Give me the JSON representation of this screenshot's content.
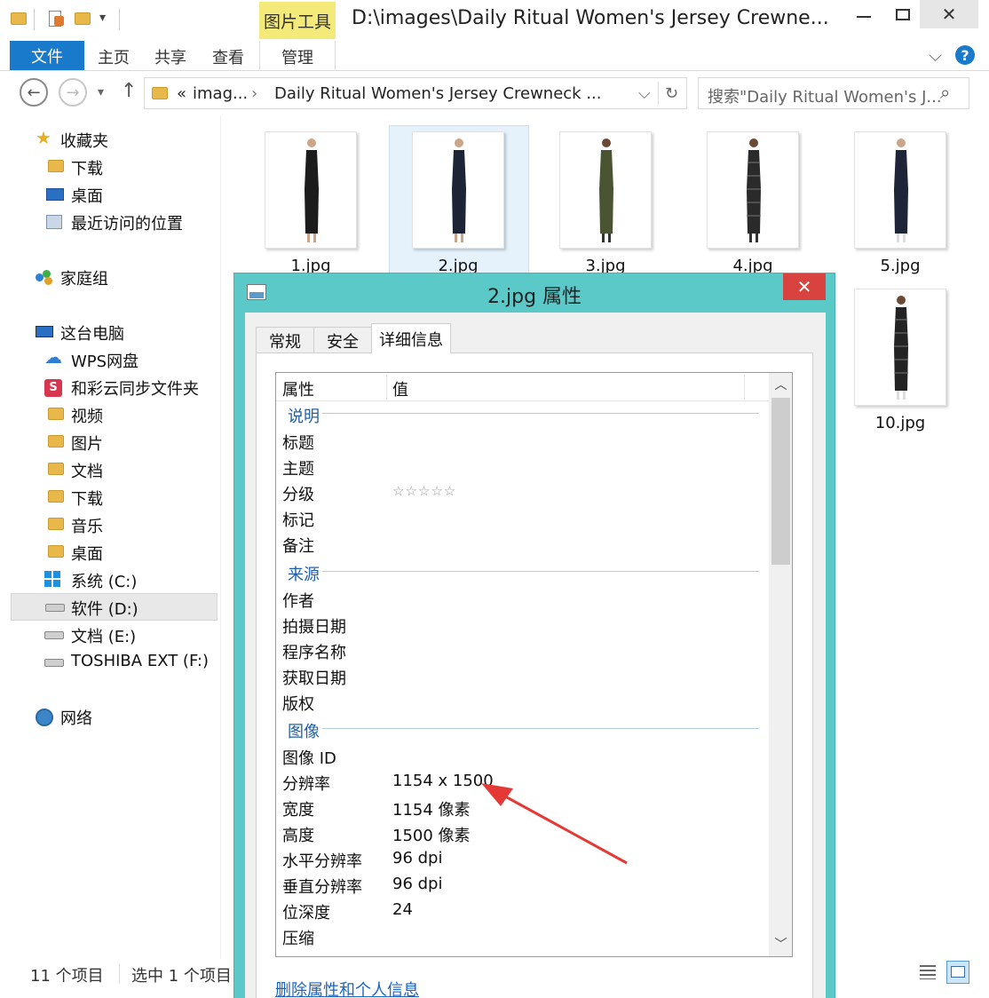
{
  "window": {
    "title": "D:\\images\\Daily Ritual Women's Jersey Crewne...",
    "tool_tab": "图片工具",
    "minimize_icon": "▭",
    "restore_icon": "□",
    "close_icon": "✕"
  },
  "ribbon": {
    "tabs": [
      "文件",
      "主页",
      "共享",
      "查看",
      "管理"
    ],
    "expand_icon": "⌵",
    "help_icon": "?"
  },
  "address": {
    "back_icon": "←",
    "forward_icon": "→",
    "recent_icon": "▾",
    "up_icon": "↑",
    "prefix": "«",
    "crumb1": "imag...",
    "sep_icon": "›",
    "crumb2": "Daily Ritual Women's Jersey Crewneck ...",
    "dropdown_icon": "⌵",
    "refresh_icon": "↻",
    "search_placeholder": "搜索\"Daily Ritual Women's J...",
    "search_icon": "⌕"
  },
  "sidebar": {
    "favorites": "收藏夹",
    "downloads": "下载",
    "desktop": "桌面",
    "recent": "最近访问的位置",
    "homegroup": "家庭组",
    "this_pc": "这台电脑",
    "wps": "WPS网盘",
    "hecaiyun": "和彩云同步文件夹",
    "videos": "视频",
    "pictures": "图片",
    "documents": "文档",
    "downloads2": "下载",
    "music": "音乐",
    "desktop2": "桌面",
    "drive_c": "系统 (C:)",
    "drive_d": "软件 (D:)",
    "drive_e": "文档 (E:)",
    "drive_f": "TOSHIBA EXT (F:)",
    "network": "网络"
  },
  "files": [
    {
      "name": "1.jpg",
      "color": "#1c1c1c"
    },
    {
      "name": "2.jpg",
      "color": "#1d2436"
    },
    {
      "name": "3.jpg",
      "color": "#4a5433"
    },
    {
      "name": "4.jpg",
      "color": "#2a2a2a"
    },
    {
      "name": "5.jpg",
      "color": "#1e2538"
    },
    {
      "name": "10.jpg",
      "color": "#232323"
    }
  ],
  "status": {
    "count": "11 个项目",
    "selected": "选中 1 个项目"
  },
  "dialog": {
    "title": "2.jpg 属性",
    "close_icon": "✕",
    "tabs": [
      "常规",
      "安全",
      "详细信息"
    ],
    "col_property": "属性",
    "col_value": "值",
    "scroll_up": "︿",
    "scroll_down": "﹀",
    "groups": {
      "description": "说明",
      "origin": "来源",
      "image": "图像"
    },
    "rows": {
      "title": "标题",
      "subject": "主题",
      "rating": "分级",
      "rating_stars": "☆☆☆☆☆",
      "tags": "标记",
      "comments": "备注",
      "authors": "作者",
      "date_taken": "拍摄日期",
      "program": "程序名称",
      "date_acquired": "获取日期",
      "copyright": "版权",
      "image_id": "图像 ID",
      "dimensions": "分辨率",
      "dimensions_val": "1154 x 1500",
      "width": "宽度",
      "width_val": "1154 像素",
      "height": "高度",
      "height_val": "1500 像素",
      "hres": "水平分辨率",
      "hres_val": "96 dpi",
      "vres": "垂直分辨率",
      "vres_val": "96 dpi",
      "bitdepth": "位深度",
      "bitdepth_val": "24",
      "compression": "压缩"
    },
    "remove_link": "删除属性和个人信息"
  },
  "colors": {
    "accent": "#1979ca",
    "dialog_frame": "#5cc9c9",
    "close_red": "#d9433f",
    "arrow_red": "#e53935",
    "group_blue": "#1f5fa8"
  }
}
